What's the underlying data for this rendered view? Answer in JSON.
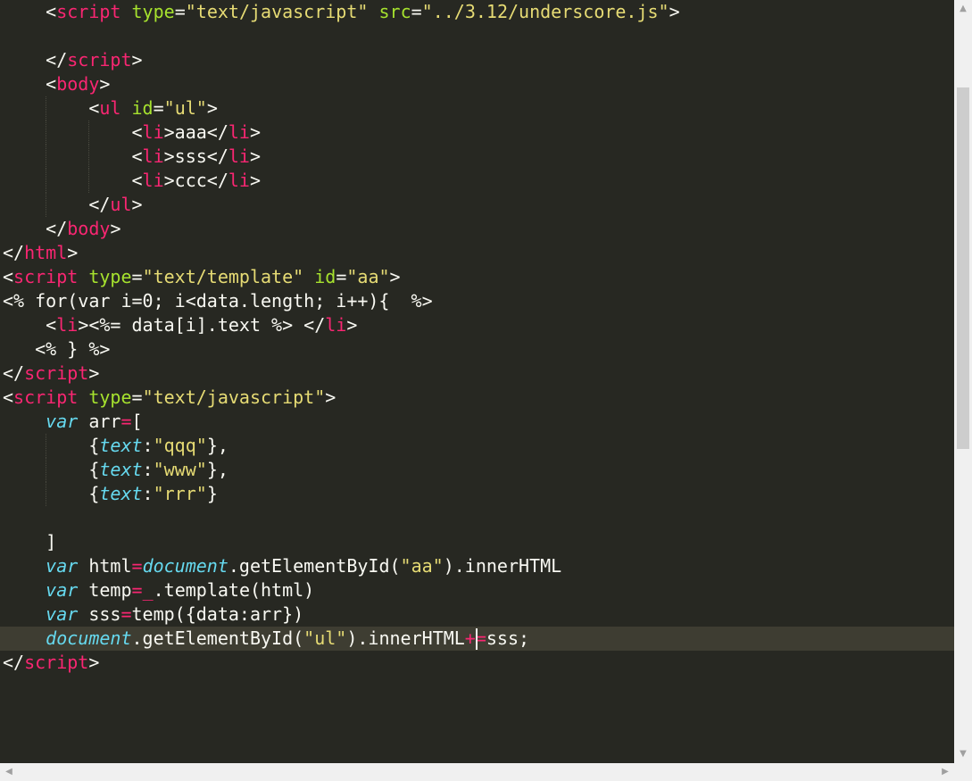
{
  "editor": {
    "current_line_index": 26,
    "lines": [
      [
        {
          "t": "    "
        },
        {
          "t": "<",
          "c": "plain"
        },
        {
          "t": "script",
          "c": "tag"
        },
        {
          "t": " "
        },
        {
          "t": "type",
          "c": "attr"
        },
        {
          "t": "="
        },
        {
          "t": "\"text/javascript\"",
          "c": "str"
        },
        {
          "t": " "
        },
        {
          "t": "src",
          "c": "attr"
        },
        {
          "t": "="
        },
        {
          "t": "\"../3.12/underscore.js\"",
          "c": "str"
        },
        {
          "t": ">"
        }
      ],
      [],
      [
        {
          "t": "    "
        },
        {
          "t": "</"
        },
        {
          "t": "script",
          "c": "tag"
        },
        {
          "t": ">"
        }
      ],
      [
        {
          "t": "    "
        },
        {
          "t": "<"
        },
        {
          "t": "body",
          "c": "tag"
        },
        {
          "t": ">"
        }
      ],
      [
        {
          "t": "        "
        },
        {
          "t": "<"
        },
        {
          "t": "ul",
          "c": "tag"
        },
        {
          "t": " "
        },
        {
          "t": "id",
          "c": "attr"
        },
        {
          "t": "="
        },
        {
          "t": "\"ul\"",
          "c": "str"
        },
        {
          "t": ">"
        }
      ],
      [
        {
          "t": "            "
        },
        {
          "t": "<"
        },
        {
          "t": "li",
          "c": "tag"
        },
        {
          "t": ">aaa</"
        },
        {
          "t": "li",
          "c": "tag"
        },
        {
          "t": ">"
        }
      ],
      [
        {
          "t": "            "
        },
        {
          "t": "<"
        },
        {
          "t": "li",
          "c": "tag"
        },
        {
          "t": ">sss</"
        },
        {
          "t": "li",
          "c": "tag"
        },
        {
          "t": ">"
        }
      ],
      [
        {
          "t": "            "
        },
        {
          "t": "<"
        },
        {
          "t": "li",
          "c": "tag"
        },
        {
          "t": ">ccc</"
        },
        {
          "t": "li",
          "c": "tag"
        },
        {
          "t": ">"
        }
      ],
      [
        {
          "t": "        "
        },
        {
          "t": "</"
        },
        {
          "t": "ul",
          "c": "tag"
        },
        {
          "t": ">"
        }
      ],
      [
        {
          "t": "    "
        },
        {
          "t": "</"
        },
        {
          "t": "body",
          "c": "tag"
        },
        {
          "t": ">"
        }
      ],
      [
        {
          "t": "</"
        },
        {
          "t": "html",
          "c": "tag"
        },
        {
          "t": ">"
        }
      ],
      [
        {
          "t": "<"
        },
        {
          "t": "script",
          "c": "tag"
        },
        {
          "t": " "
        },
        {
          "t": "type",
          "c": "attr"
        },
        {
          "t": "="
        },
        {
          "t": "\"text/template\"",
          "c": "str"
        },
        {
          "t": " "
        },
        {
          "t": "id",
          "c": "attr"
        },
        {
          "t": "="
        },
        {
          "t": "\"aa\"",
          "c": "str"
        },
        {
          "t": ">"
        }
      ],
      [
        {
          "t": "<% for(var i=0; i<data.length; i++){  %>"
        }
      ],
      [
        {
          "t": "    "
        },
        {
          "t": "<"
        },
        {
          "t": "li",
          "c": "tag"
        },
        {
          "t": "><%= data[i].text %> </"
        },
        {
          "t": "li",
          "c": "tag"
        },
        {
          "t": ">"
        }
      ],
      [
        {
          "t": "   <% } %>"
        }
      ],
      [
        {
          "t": "</"
        },
        {
          "t": "script",
          "c": "tag"
        },
        {
          "t": ">"
        }
      ],
      [
        {
          "t": "<"
        },
        {
          "t": "script",
          "c": "tag"
        },
        {
          "t": " "
        },
        {
          "t": "type",
          "c": "attr"
        },
        {
          "t": "="
        },
        {
          "t": "\"text/javascript\"",
          "c": "str"
        },
        {
          "t": ">"
        }
      ],
      [
        {
          "t": "    "
        },
        {
          "t": "var",
          "c": "kw"
        },
        {
          "t": " arr"
        },
        {
          "t": "=",
          "c": "op"
        },
        {
          "t": "["
        }
      ],
      [
        {
          "t": "        {"
        },
        {
          "t": "text",
          "c": "kw"
        },
        {
          "t": ":"
        },
        {
          "t": "\"qqq\"",
          "c": "str"
        },
        {
          "t": "},"
        }
      ],
      [
        {
          "t": "        {"
        },
        {
          "t": "text",
          "c": "kw"
        },
        {
          "t": ":"
        },
        {
          "t": "\"www\"",
          "c": "str"
        },
        {
          "t": "},"
        }
      ],
      [
        {
          "t": "        {"
        },
        {
          "t": "text",
          "c": "kw"
        },
        {
          "t": ":"
        },
        {
          "t": "\"rrr\"",
          "c": "str"
        },
        {
          "t": "}"
        }
      ],
      [],
      [
        {
          "t": "    ]"
        }
      ],
      [
        {
          "t": "    "
        },
        {
          "t": "var",
          "c": "kw"
        },
        {
          "t": " html"
        },
        {
          "t": "=",
          "c": "op"
        },
        {
          "t": "document",
          "c": "obj"
        },
        {
          "t": ".getElementById("
        },
        {
          "t": "\"aa\"",
          "c": "str"
        },
        {
          "t": ").innerHTML"
        }
      ],
      [
        {
          "t": "    "
        },
        {
          "t": "var",
          "c": "kw"
        },
        {
          "t": " temp"
        },
        {
          "t": "=",
          "c": "op"
        },
        {
          "t": "_",
          "c": "op"
        },
        {
          "t": ".template(html)"
        }
      ],
      [
        {
          "t": "    "
        },
        {
          "t": "var",
          "c": "kw"
        },
        {
          "t": " sss"
        },
        {
          "t": "=",
          "c": "op"
        },
        {
          "t": "temp({data:arr})"
        }
      ],
      [
        {
          "t": "    "
        },
        {
          "t": "document",
          "c": "obj"
        },
        {
          "t": ".getElementById("
        },
        {
          "t": "\"ul\"",
          "c": "str"
        },
        {
          "t": ").innerHTML"
        },
        {
          "t": "+",
          "c": "op"
        },
        {
          "t": "=",
          "c": "op"
        },
        {
          "t": "sss;"
        }
      ],
      [
        {
          "t": "</"
        },
        {
          "t": "script",
          "c": "tag"
        },
        {
          "t": ">"
        }
      ]
    ]
  },
  "scrollbars": {
    "up_arrow": "▲",
    "down_arrow": "▼",
    "left_arrow": "◀",
    "right_arrow": "▶"
  }
}
